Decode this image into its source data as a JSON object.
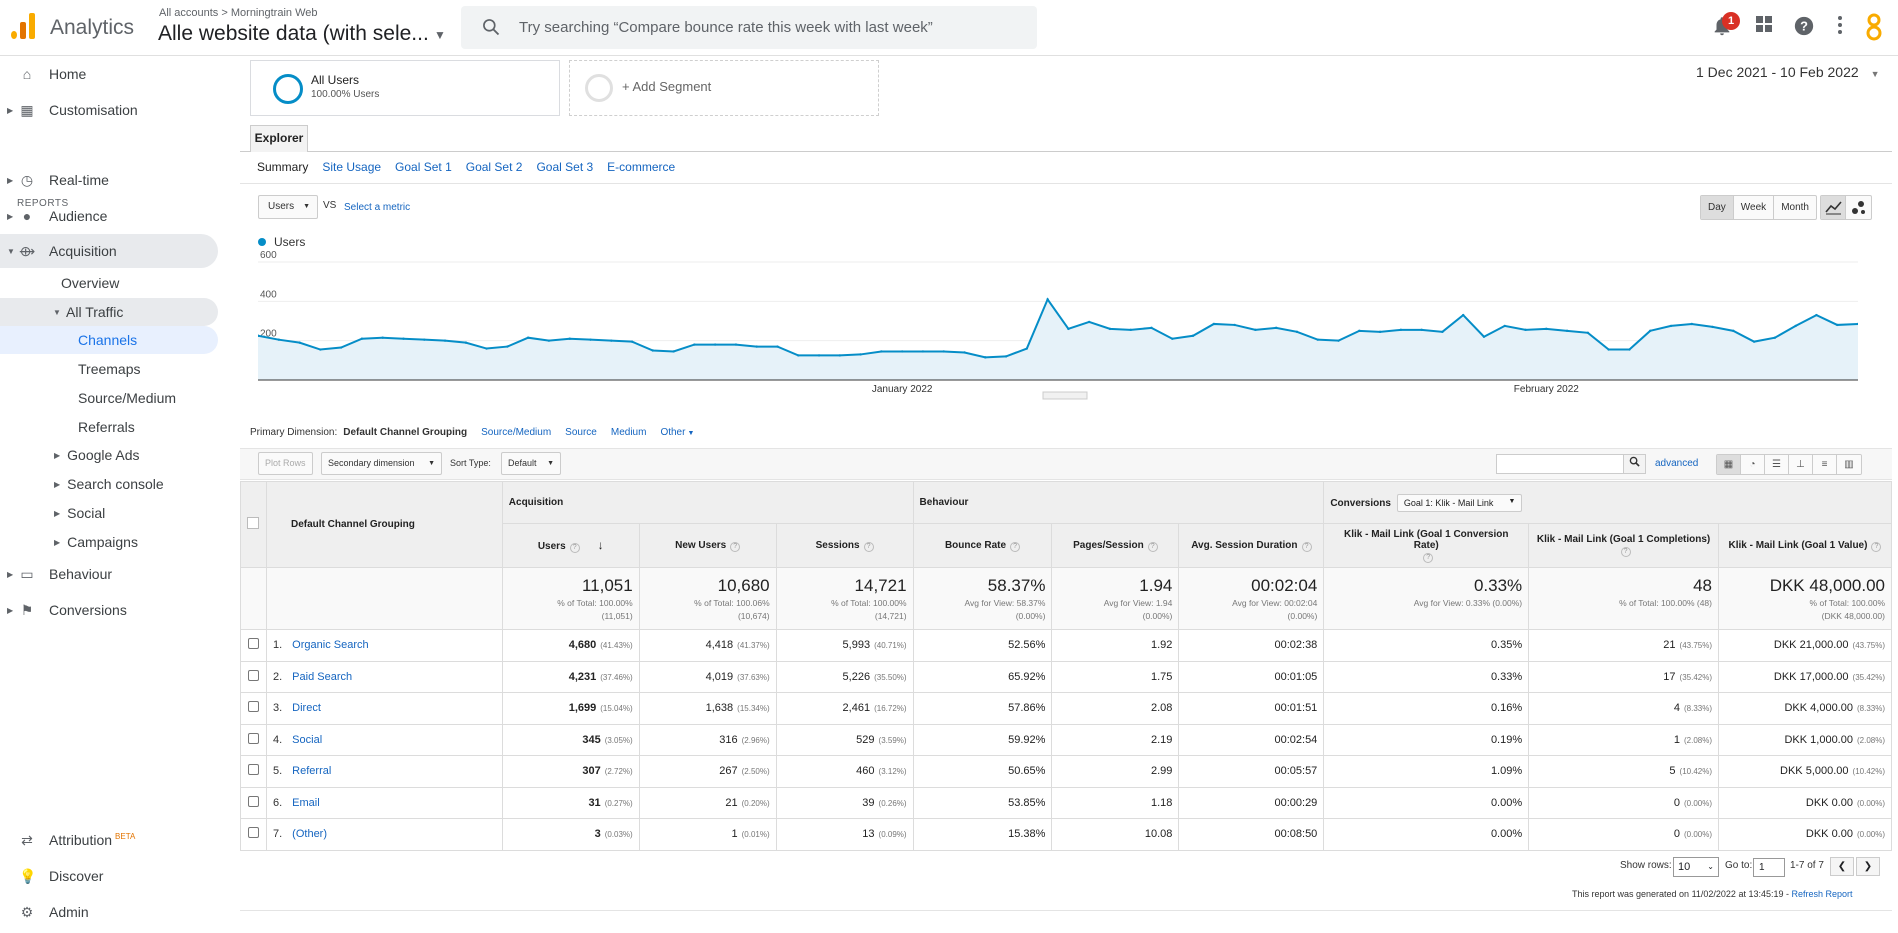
{
  "header": {
    "product": "Analytics",
    "breadcrumb_root": "All accounts",
    "breadcrumb_sep": ">",
    "breadcrumb_account": "Morningtrain Web",
    "property": "Alle website data (with sele...",
    "search_placeholder": "Try searching “Compare bounce rate this week with last week”",
    "notification_count": "1"
  },
  "sidebar": {
    "home": "Home",
    "customisation": "Customisation",
    "reports_heading": "REPORTS",
    "realtime": "Real-time",
    "audience": "Audience",
    "acquisition": "Acquisition",
    "overview": "Overview",
    "all_traffic": "All Traffic",
    "channels": "Channels",
    "treemaps": "Treemaps",
    "source_medium": "Source/Medium",
    "referrals": "Referrals",
    "google_ads": "Google Ads",
    "search_console": "Search console",
    "social": "Social",
    "campaigns": "Campaigns",
    "behaviour": "Behaviour",
    "conversions": "Conversions",
    "attribution": "Attribution",
    "attribution_badge": "BETA",
    "discover": "Discover",
    "admin": "Admin"
  },
  "segments": {
    "seg1_title": "All Users",
    "seg1_sub": "100.00% Users",
    "add_segment": "+ Add Segment"
  },
  "date_range": "1 Dec 2021 - 10 Feb 2022",
  "tabs": {
    "explorer": "Explorer",
    "sub": [
      "Summary",
      "Site Usage",
      "Goal Set 1",
      "Goal Set 2",
      "Goal Set 3",
      "E-commerce"
    ]
  },
  "metric_bar": {
    "metric": "Users",
    "vs": "VS",
    "select_metric": "Select a metric",
    "day": "Day",
    "week": "Week",
    "month": "Month"
  },
  "chart_data": {
    "type": "line",
    "series": [
      {
        "name": "Users",
        "values": [
          225,
          205,
          190,
          155,
          165,
          210,
          215,
          210,
          205,
          200,
          190,
          160,
          170,
          215,
          200,
          210,
          205,
          200,
          195,
          150,
          145,
          180,
          180,
          180,
          170,
          170,
          125,
          125,
          125,
          130,
          145,
          145,
          145,
          145,
          140,
          115,
          120,
          160,
          410,
          260,
          295,
          260,
          255,
          265,
          210,
          225,
          285,
          280,
          255,
          265,
          245,
          205,
          200,
          250,
          245,
          255,
          255,
          245,
          330,
          220,
          275,
          255,
          260,
          250,
          240,
          155,
          155,
          250,
          275,
          285,
          270,
          250,
          195,
          215,
          275,
          330,
          280,
          285
        ]
      }
    ],
    "x_tick_labels": [
      "January 2022",
      "February 2022"
    ],
    "y_tick_labels": [
      "600",
      "400",
      "200"
    ],
    "ylim": [
      0,
      600
    ],
    "color": "#058dc7"
  },
  "primary_dimension": {
    "label": "Primary Dimension:",
    "current": "Default Channel Grouping",
    "options": [
      "Source/Medium",
      "Source",
      "Medium",
      "Other"
    ]
  },
  "toolbar": {
    "plot_rows": "Plot Rows",
    "secondary_dimension": "Secondary dimension",
    "sort_type_label": "Sort Type:",
    "sort_type": "Default",
    "advanced": "advanced"
  },
  "table": {
    "dimension_header": "Default Channel Grouping",
    "groups": {
      "acquisition": "Acquisition",
      "behaviour": "Behaviour",
      "conversions": "Conversions",
      "goal_select": "Goal 1: Klik - Mail Link"
    },
    "columns": [
      "Users",
      "New Users",
      "Sessions",
      "Bounce Rate",
      "Pages/Session",
      "Avg. Session Duration",
      "Klik - Mail Link (Goal 1 Conversion Rate)",
      "Klik - Mail Link (Goal 1 Completions)",
      "Klik - Mail Link (Goal 1 Value)"
    ],
    "totals": [
      {
        "v": "11,051",
        "s1": "% of Total: 100.00%",
        "s2": "(11,051)"
      },
      {
        "v": "10,680",
        "s1": "% of Total: 100.06%",
        "s2": "(10,674)"
      },
      {
        "v": "14,721",
        "s1": "% of Total: 100.00%",
        "s2": "(14,721)"
      },
      {
        "v": "58.37%",
        "s1": "Avg for View: 58.37%",
        "s2": "(0.00%)"
      },
      {
        "v": "1.94",
        "s1": "Avg for View: 1.94",
        "s2": "(0.00%)"
      },
      {
        "v": "00:02:04",
        "s1": "Avg for View: 00:02:04",
        "s2": "(0.00%)"
      },
      {
        "v": "0.33%",
        "s1": "Avg for View: 0.33% (0.00%)",
        "s2": ""
      },
      {
        "v": "48",
        "s1": "% of Total: 100.00% (48)",
        "s2": ""
      },
      {
        "v": "DKK 48,000.00",
        "s1": "% of Total: 100.00%",
        "s2": "(DKK 48,000.00)"
      }
    ],
    "rows": [
      {
        "idx": "1.",
        "name": "Organic Search",
        "users": "4,680",
        "users_pct": "(41.43%)",
        "new": "4,418",
        "new_pct": "(41.37%)",
        "sess": "5,993",
        "sess_pct": "(40.71%)",
        "bounce": "52.56%",
        "pps": "1.92",
        "dur": "00:02:38",
        "cr": "0.35%",
        "comp": "21",
        "comp_pct": "(43.75%)",
        "val": "DKK 21,000.00",
        "val_pct": "(43.75%)"
      },
      {
        "idx": "2.",
        "name": "Paid Search",
        "users": "4,231",
        "users_pct": "(37.46%)",
        "new": "4,019",
        "new_pct": "(37.63%)",
        "sess": "5,226",
        "sess_pct": "(35.50%)",
        "bounce": "65.92%",
        "pps": "1.75",
        "dur": "00:01:05",
        "cr": "0.33%",
        "comp": "17",
        "comp_pct": "(35.42%)",
        "val": "DKK 17,000.00",
        "val_pct": "(35.42%)"
      },
      {
        "idx": "3.",
        "name": "Direct",
        "users": "1,699",
        "users_pct": "(15.04%)",
        "new": "1,638",
        "new_pct": "(15.34%)",
        "sess": "2,461",
        "sess_pct": "(16.72%)",
        "bounce": "57.86%",
        "pps": "2.08",
        "dur": "00:01:51",
        "cr": "0.16%",
        "comp": "4",
        "comp_pct": "(8.33%)",
        "val": "DKK 4,000.00",
        "val_pct": "(8.33%)"
      },
      {
        "idx": "4.",
        "name": "Social",
        "users": "345",
        "users_pct": "(3.05%)",
        "new": "316",
        "new_pct": "(2.96%)",
        "sess": "529",
        "sess_pct": "(3.59%)",
        "bounce": "59.92%",
        "pps": "2.19",
        "dur": "00:02:54",
        "cr": "0.19%",
        "comp": "1",
        "comp_pct": "(2.08%)",
        "val": "DKK 1,000.00",
        "val_pct": "(2.08%)"
      },
      {
        "idx": "5.",
        "name": "Referral",
        "users": "307",
        "users_pct": "(2.72%)",
        "new": "267",
        "new_pct": "(2.50%)",
        "sess": "460",
        "sess_pct": "(3.12%)",
        "bounce": "50.65%",
        "pps": "2.99",
        "dur": "00:05:57",
        "cr": "1.09%",
        "comp": "5",
        "comp_pct": "(10.42%)",
        "val": "DKK 5,000.00",
        "val_pct": "(10.42%)"
      },
      {
        "idx": "6.",
        "name": "Email",
        "users": "31",
        "users_pct": "(0.27%)",
        "new": "21",
        "new_pct": "(0.20%)",
        "sess": "39",
        "sess_pct": "(0.26%)",
        "bounce": "53.85%",
        "pps": "1.18",
        "dur": "00:00:29",
        "cr": "0.00%",
        "comp": "0",
        "comp_pct": "(0.00%)",
        "val": "DKK 0.00",
        "val_pct": "(0.00%)"
      },
      {
        "idx": "7.",
        "name": "(Other)",
        "users": "3",
        "users_pct": "(0.03%)",
        "new": "1",
        "new_pct": "(0.01%)",
        "sess": "13",
        "sess_pct": "(0.09%)",
        "bounce": "15.38%",
        "pps": "10.08",
        "dur": "00:08:50",
        "cr": "0.00%",
        "comp": "0",
        "comp_pct": "(0.00%)",
        "val": "DKK 0.00",
        "val_pct": "(0.00%)"
      }
    ]
  },
  "pagination": {
    "show_rows_label": "Show rows:",
    "show_rows": "10",
    "go_to_label": "Go to:",
    "go_to": "1",
    "range": "1-7 of 7"
  },
  "footer": {
    "generated": "This report was generated on 11/02/2022 at 13:45:19 -",
    "refresh": "Refresh Report"
  }
}
